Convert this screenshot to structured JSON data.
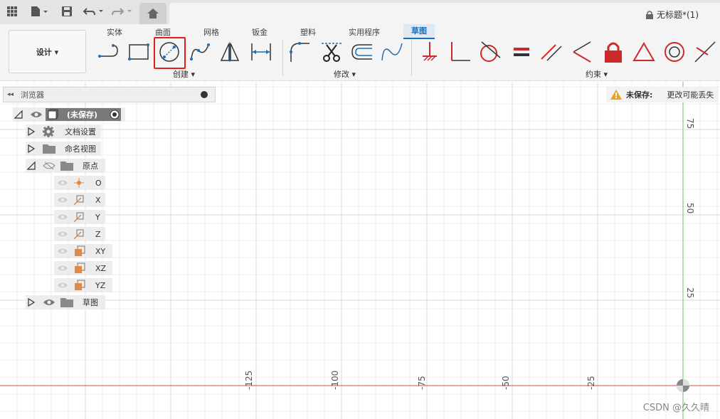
{
  "app": {
    "doc_title": "无标题*(1)"
  },
  "ribbon": {
    "design_label": "设计 ▾",
    "tabs": [
      "实体",
      "曲面",
      "网格",
      "钣金",
      "塑料",
      "实用程序",
      "草图"
    ],
    "active_tab": "草图",
    "groups": {
      "create": "创建 ▾",
      "modify": "修改 ▾",
      "constraints": "约束 ▾"
    }
  },
  "browser": {
    "title": "浏览器",
    "root": "(未保存)",
    "items": [
      {
        "label": "文档设置",
        "icon": "gear-icon"
      },
      {
        "label": "命名视图",
        "icon": "folder-icon"
      },
      {
        "label": "原点",
        "icon": "folder-icon"
      },
      {
        "label": "O",
        "icon": "origin-point-icon"
      },
      {
        "label": "X",
        "icon": "axis-icon"
      },
      {
        "label": "Y",
        "icon": "axis-icon"
      },
      {
        "label": "Z",
        "icon": "axis-icon"
      },
      {
        "label": "XY",
        "icon": "plane-icon"
      },
      {
        "label": "XZ",
        "icon": "plane-icon"
      },
      {
        "label": "YZ",
        "icon": "plane-icon"
      },
      {
        "label": "草图",
        "icon": "folder-icon"
      }
    ]
  },
  "notice": {
    "title": "未保存:",
    "message": "更改可能丢失"
  },
  "axes": {
    "x_ticks": [
      "-125",
      "-100",
      "-75",
      "-50",
      "-25"
    ],
    "y_ticks": [
      "75",
      "50",
      "25"
    ]
  },
  "watermark": "CSDN @久久晴",
  "colors": {
    "accent": "#1d6fb8",
    "highlight": "#e0201b",
    "constraint_red": "#cc2a2a",
    "x_axis": "#e07070",
    "y_axis": "#86cc86"
  }
}
